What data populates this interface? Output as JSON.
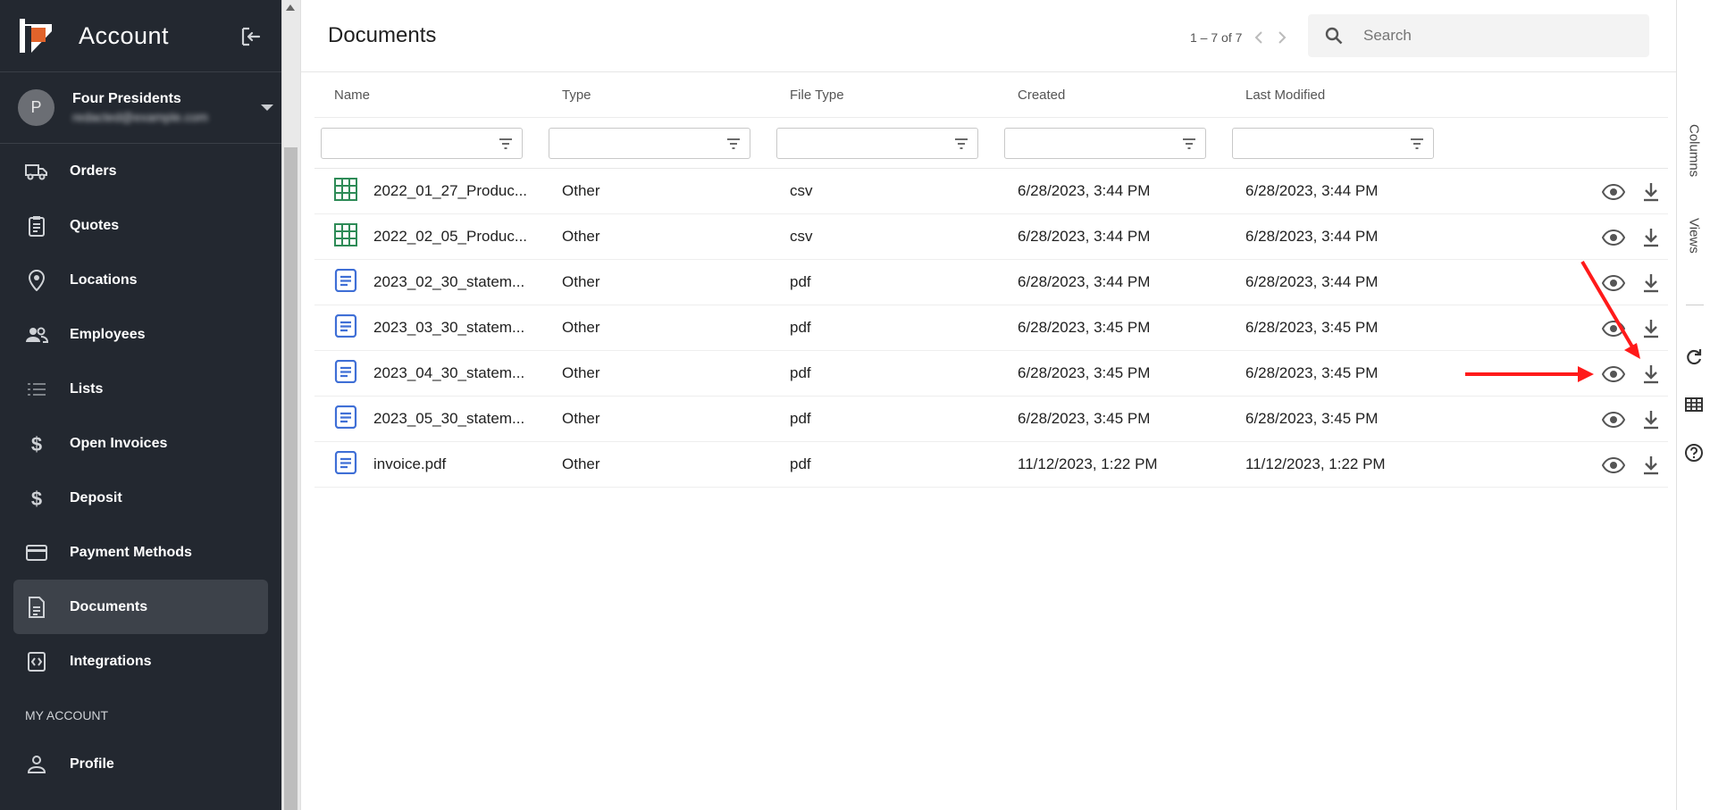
{
  "app": {
    "title": "Account"
  },
  "user": {
    "initial": "P",
    "name": "Four Presidents",
    "email": "redacted@example.com"
  },
  "nav": [
    {
      "label": "Orders",
      "icon": "truck-icon"
    },
    {
      "label": "Quotes",
      "icon": "clipboard-icon"
    },
    {
      "label": "Locations",
      "icon": "location-pin-icon"
    },
    {
      "label": "Employees",
      "icon": "people-icon"
    },
    {
      "label": "Lists",
      "icon": "list-icon"
    },
    {
      "label": "Open Invoices",
      "icon": "dollar-icon"
    },
    {
      "label": "Deposit",
      "icon": "dollar-icon"
    },
    {
      "label": "Payment Methods",
      "icon": "credit-card-icon"
    },
    {
      "label": "Documents",
      "icon": "document-icon",
      "active": true
    },
    {
      "label": "Integrations",
      "icon": "integrations-icon"
    }
  ],
  "my_account": {
    "section_label": "MY ACCOUNT",
    "profile_label": "Profile"
  },
  "main": {
    "title": "Documents",
    "pager": "1 – 7 of 7",
    "search_placeholder": "Search"
  },
  "table": {
    "columns": [
      "Name",
      "Type",
      "File Type",
      "Created",
      "Last Modified"
    ],
    "rows": [
      {
        "name": "2022_01_27_Produc...",
        "type": "Other",
        "ftype": "csv",
        "created": "6/28/2023, 3:44 PM",
        "modified": "6/28/2023, 3:44 PM",
        "icon": "spreadsheet-icon"
      },
      {
        "name": "2022_02_05_Produc...",
        "type": "Other",
        "ftype": "csv",
        "created": "6/28/2023, 3:44 PM",
        "modified": "6/28/2023, 3:44 PM",
        "icon": "spreadsheet-icon"
      },
      {
        "name": "2023_02_30_statem...",
        "type": "Other",
        "ftype": "pdf",
        "created": "6/28/2023, 3:44 PM",
        "modified": "6/28/2023, 3:44 PM",
        "icon": "document-icon"
      },
      {
        "name": "2023_03_30_statem...",
        "type": "Other",
        "ftype": "pdf",
        "created": "6/28/2023, 3:45 PM",
        "modified": "6/28/2023, 3:45 PM",
        "icon": "document-icon"
      },
      {
        "name": "2023_04_30_statem...",
        "type": "Other",
        "ftype": "pdf",
        "created": "6/28/2023, 3:45 PM",
        "modified": "6/28/2023, 3:45 PM",
        "icon": "document-icon"
      },
      {
        "name": "2023_05_30_statem...",
        "type": "Other",
        "ftype": "pdf",
        "created": "6/28/2023, 3:45 PM",
        "modified": "6/28/2023, 3:45 PM",
        "icon": "document-icon"
      },
      {
        "name": "invoice.pdf",
        "type": "Other",
        "ftype": "pdf",
        "created": "11/12/2023, 1:22 PM",
        "modified": "11/12/2023, 1:22 PM",
        "icon": "document-icon"
      }
    ]
  },
  "rail": {
    "columns_label": "Columns",
    "views_label": "Views"
  },
  "colors": {
    "sidebar_bg": "#232830",
    "active_bg": "#3d424a",
    "logo_orange": "#e0632b",
    "csv_green": "#2e8b57",
    "pdf_blue": "#3f6fd6",
    "annotation_red": "#ff1a1a"
  }
}
